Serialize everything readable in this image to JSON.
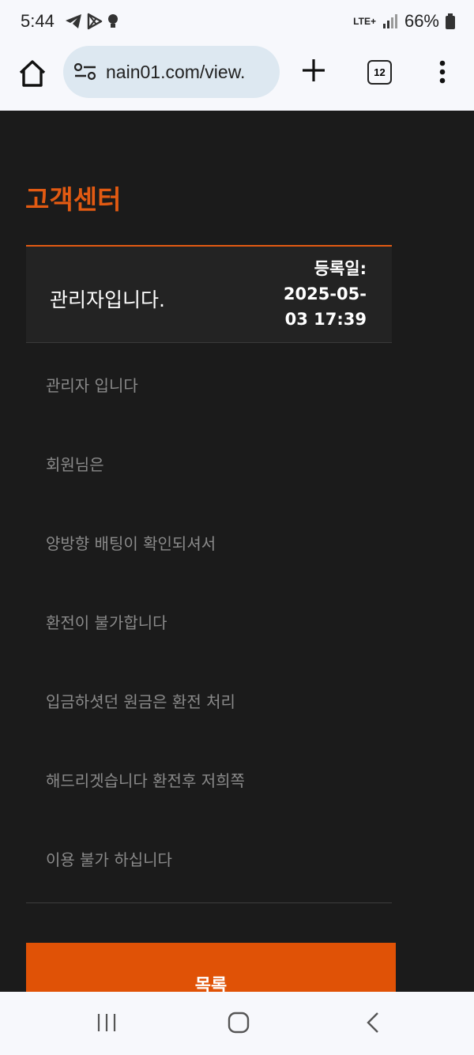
{
  "status_bar": {
    "time": "5:44",
    "network": "LTE+",
    "battery": "66%"
  },
  "browser": {
    "url": "nain01.com/view.",
    "tab_count": "12",
    "icons": [
      "home-icon",
      "site-info-icon",
      "plus-icon",
      "tabs-icon",
      "more-vert-icon"
    ]
  },
  "page": {
    "title": "고객센터",
    "post": {
      "title": "관리자입니다.",
      "date_label": "등록일:",
      "date_line1": "2025-05-",
      "date_line2": "03 17:39"
    },
    "body_lines": [
      "관리자 입니다",
      "회원님은",
      "양방향 배팅이 확인되셔서",
      "환전이 불가합니다",
      "입금하셧던 원금은 환전 처리",
      "해드리겟습니다 환전후 저희쪽",
      "이용 불가 하십니다"
    ],
    "list_button": "목록"
  },
  "colors": {
    "accent": "#e05206",
    "background": "#1b1b1b",
    "body_text": "#8a8a8a"
  },
  "nav_bar": {
    "icons": [
      "recents-icon",
      "home-circle-icon",
      "back-icon"
    ]
  }
}
